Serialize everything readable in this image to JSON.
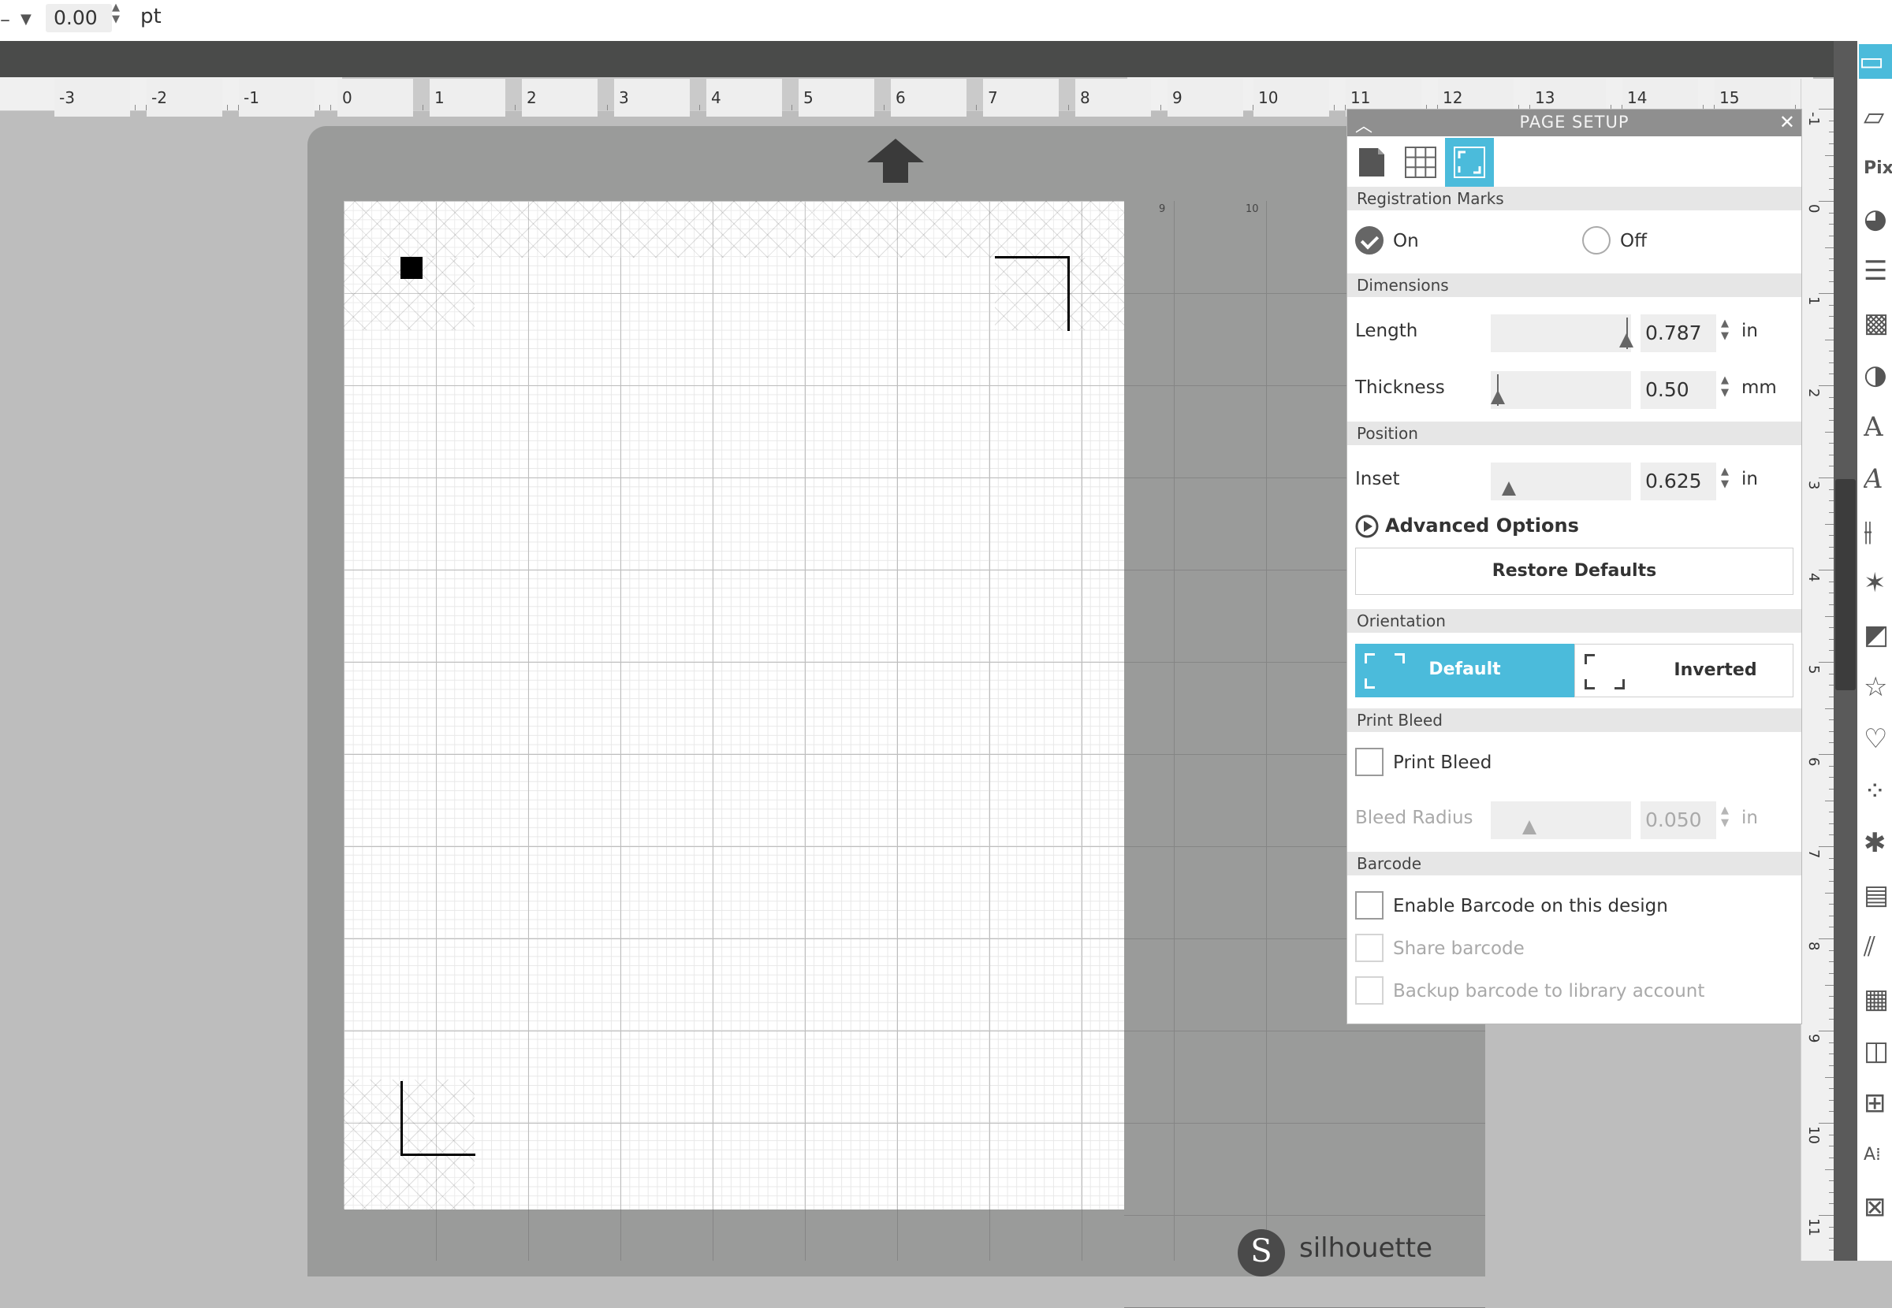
{
  "toolbar": {
    "line_width_value": "0.00",
    "line_width_unit": "pt"
  },
  "ruler": {
    "labels": [
      "-3",
      "-2",
      "-1",
      "0",
      "1",
      "2",
      "3",
      "4",
      "5",
      "6",
      "7",
      "8",
      "9",
      "10",
      "11",
      "12",
      "13",
      "14",
      "15"
    ],
    "vlabels": [
      "-1",
      "0",
      "1",
      "2",
      "3",
      "4",
      "5",
      "6",
      "7",
      "8",
      "9",
      "10",
      "11"
    ]
  },
  "mat": {
    "labels": [
      "9",
      "10"
    ],
    "brand": "silhouette"
  },
  "panel": {
    "title": "PAGE SETUP",
    "sections": {
      "registration": "Registration Marks",
      "dimensions": "Dimensions",
      "position": "Position",
      "orientation": "Orientation",
      "print_bleed": "Print Bleed",
      "barcode": "Barcode"
    },
    "registration": {
      "on_label": "On",
      "off_label": "Off",
      "selected": "On"
    },
    "dimensions": {
      "length_label": "Length",
      "length_value": "0.787",
      "length_unit": "in",
      "thickness_label": "Thickness",
      "thickness_value": "0.50",
      "thickness_unit": "mm"
    },
    "position": {
      "inset_label": "Inset",
      "inset_value": "0.625",
      "inset_unit": "in"
    },
    "advanced_label": "Advanced Options",
    "restore_label": "Restore Defaults",
    "orientation": {
      "default_label": "Default",
      "inverted_label": "Inverted",
      "selected": "Default"
    },
    "print_bleed": {
      "checkbox_label": "Print Bleed",
      "checked": false,
      "radius_label": "Bleed Radius",
      "radius_value": "0.050",
      "radius_unit": "in"
    },
    "barcode": {
      "enable_label": "Enable Barcode on this design",
      "share_label": "Share barcode",
      "backup_label": "Backup barcode to library account"
    }
  },
  "colors": {
    "accent": "#4bbbdb",
    "panel_title_bg": "#8f8f8f",
    "mat": "#9a9b9a",
    "dark_bar": "#4a4b4a"
  },
  "icons": [
    "page-setup-icon",
    "send-icon",
    "pixscan-icon",
    "fill-color-icon",
    "line-style-icon",
    "fill-pattern-icon",
    "transparency-icon",
    "text-style-icon",
    "font-icon",
    "align-icon",
    "replicate-icon",
    "transform-icon",
    "offset-icon",
    "trace-icon",
    "modify-icon",
    "knife-icon",
    "nesting-icon",
    "design-store-icon",
    "library-icon",
    "layers-icon",
    "sketch-icon",
    "cut-settings-icon"
  ]
}
